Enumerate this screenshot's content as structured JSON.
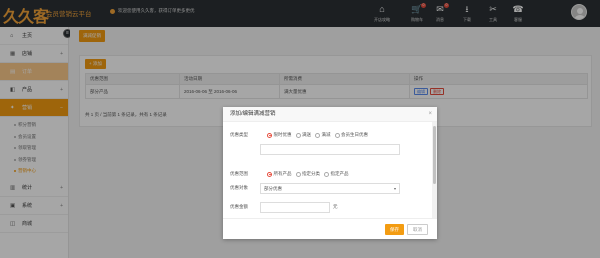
{
  "header": {
    "logo_text": "久久客",
    "brand_title": "会员营销云平台",
    "notice": "欢迎您使用久久客，获得订单更多更优",
    "nav": [
      {
        "label": "开店攻略",
        "icon": "storefront-icon"
      },
      {
        "label": "购物车",
        "icon": "cart-icon",
        "badge": "0"
      },
      {
        "label": "消息",
        "icon": "message-icon",
        "badge": "0"
      },
      {
        "label": "下载",
        "icon": "download-icon"
      },
      {
        "label": "工具",
        "icon": "tools-icon"
      },
      {
        "label": "客服",
        "icon": "headset-icon"
      }
    ]
  },
  "sidebar": {
    "items": [
      {
        "label": "主页",
        "icon": "home-icon"
      },
      {
        "label": "店铺",
        "icon": "shop-icon",
        "arrow": "+"
      },
      {
        "label": "订单",
        "icon": "order-icon"
      },
      {
        "label": "产品",
        "icon": "product-icon",
        "arrow": "+"
      },
      {
        "label": "营销",
        "icon": "marketing-icon",
        "arrow": "−"
      }
    ],
    "sub_items": [
      "积分营销",
      "会员设置",
      "领取管理",
      "领券管理",
      "营销中心"
    ],
    "bottom_items": [
      {
        "label": "统计",
        "icon": "stats-icon",
        "arrow": "+"
      },
      {
        "label": "系统",
        "icon": "system-icon",
        "arrow": "+"
      },
      {
        "label": "商城",
        "icon": "mall-icon"
      }
    ]
  },
  "main": {
    "crumb": "满减促销",
    "add_label": "+ 添加",
    "columns": [
      "优惠范围",
      "活动日期",
      "所需消费",
      "操作"
    ],
    "rows": [
      {
        "scope": "部分产品",
        "date": "2016-06-06 至 2016-06-06",
        "spend": "满大量优惠",
        "edit": "编辑",
        "del": "删除"
      }
    ],
    "pager": "共 1 页 / 当前第 1 条记录，共有 1 条记录"
  },
  "modal": {
    "title": "添加/编辑满减营销",
    "type_label": "优惠类型",
    "type_options": [
      "限时优惠",
      "满送",
      "满减",
      "会员生日优惠"
    ],
    "scope_label": "优惠范围",
    "scope_options": [
      "所有产品",
      "指定分类",
      "指定产品"
    ],
    "object_label": "优惠对象",
    "object_value": "部分优惠",
    "amount_label": "优惠金额",
    "amount_unit": "元",
    "save_label": "保存",
    "cancel_label": "取消"
  }
}
